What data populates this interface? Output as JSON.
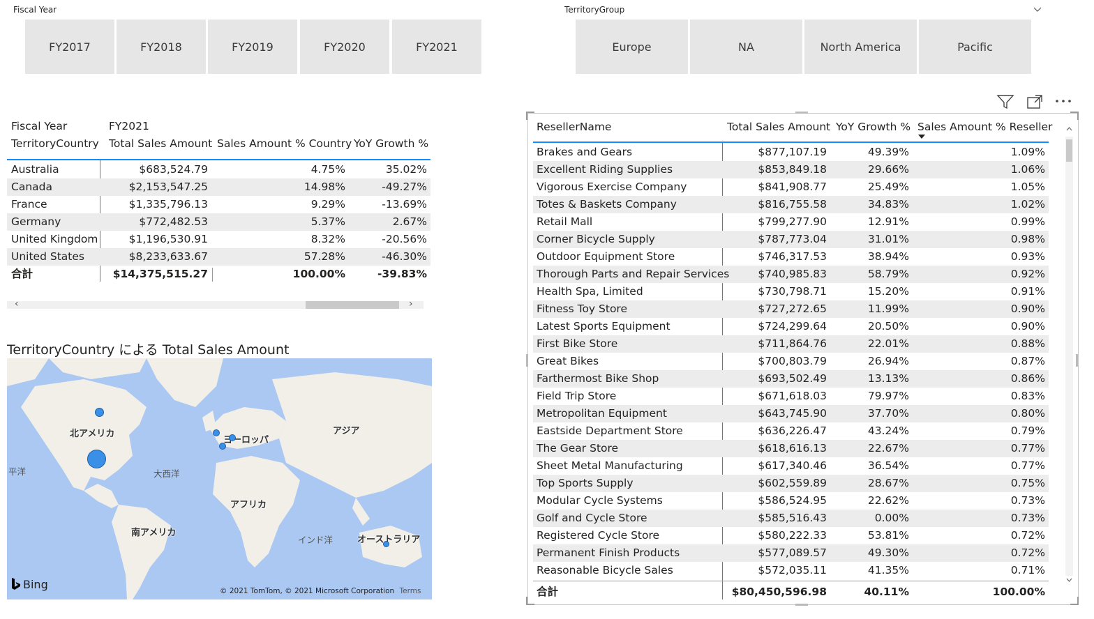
{
  "fiscal_slicer": {
    "title": "Fiscal Year",
    "items": [
      "FY2017",
      "FY2018",
      "FY2019",
      "FY2020",
      "FY2021"
    ]
  },
  "territory_slicer": {
    "title": "TerritoryGroup",
    "items": [
      "Europe",
      "NA",
      "North America",
      "Pacific"
    ]
  },
  "matrix": {
    "col_header_label": "Fiscal Year",
    "col_header_value": "FY2021",
    "row_header": "TerritoryCountry",
    "measures": [
      "Total Sales Amount",
      "Sales Amount % Country",
      "YoY Growth %"
    ],
    "rows": [
      {
        "country": "Australia",
        "sales": "$683,524.79",
        "pct": "4.75%",
        "yoy": "35.02%"
      },
      {
        "country": "Canada",
        "sales": "$2,153,547.25",
        "pct": "14.98%",
        "yoy": "-49.27%"
      },
      {
        "country": "France",
        "sales": "$1,335,796.13",
        "pct": "9.29%",
        "yoy": "-13.69%"
      },
      {
        "country": "Germany",
        "sales": "$772,482.53",
        "pct": "5.37%",
        "yoy": "2.67%"
      },
      {
        "country": "United Kingdom",
        "sales": "$1,196,530.91",
        "pct": "8.32%",
        "yoy": "-20.56%"
      },
      {
        "country": "United States",
        "sales": "$8,233,633.67",
        "pct": "57.28%",
        "yoy": "-46.30%"
      }
    ],
    "total": {
      "label": "合計",
      "sales": "$14,375,515.27",
      "pct": "100.00%",
      "yoy": "-39.83%"
    },
    "scroll_left": "‹",
    "scroll_right": "›"
  },
  "map": {
    "title": "TerritoryCountry による Total Sales Amount",
    "labels": {
      "north_america": "北アメリカ",
      "europe": "ヨーロッパ",
      "asia": "アジア",
      "africa": "アフリカ",
      "south_america": "南アメリカ",
      "oceania": "オーストラリア",
      "atlantic": "大西洋",
      "pacific": "平洋",
      "indian": "インド洋"
    },
    "bing": "Bing",
    "copyright": "© 2021 TomTom, © 2021 Microsoft Corporation",
    "terms": "Terms"
  },
  "reseller_table": {
    "headers": [
      "ResellerName",
      "Total Sales Amount",
      "YoY Growth %",
      "Sales Amount % Reseller"
    ],
    "rows": [
      {
        "name": "Brakes and Gears",
        "sales": "$877,107.19",
        "yoy": "49.39%",
        "pct": "1.09%"
      },
      {
        "name": "Excellent Riding Supplies",
        "sales": "$853,849.18",
        "yoy": "29.66%",
        "pct": "1.06%"
      },
      {
        "name": "Vigorous Exercise Company",
        "sales": "$841,908.77",
        "yoy": "25.49%",
        "pct": "1.05%"
      },
      {
        "name": "Totes & Baskets Company",
        "sales": "$816,755.58",
        "yoy": "34.83%",
        "pct": "1.02%"
      },
      {
        "name": "Retail Mall",
        "sales": "$799,277.90",
        "yoy": "12.91%",
        "pct": "0.99%"
      },
      {
        "name": "Corner Bicycle Supply",
        "sales": "$787,773.04",
        "yoy": "31.01%",
        "pct": "0.98%"
      },
      {
        "name": "Outdoor Equipment Store",
        "sales": "$746,317.53",
        "yoy": "38.94%",
        "pct": "0.93%"
      },
      {
        "name": "Thorough Parts and Repair Services",
        "sales": "$740,985.83",
        "yoy": "58.79%",
        "pct": "0.92%"
      },
      {
        "name": "Health Spa, Limited",
        "sales": "$730,798.71",
        "yoy": "15.20%",
        "pct": "0.91%"
      },
      {
        "name": "Fitness Toy Store",
        "sales": "$727,272.65",
        "yoy": "11.99%",
        "pct": "0.90%"
      },
      {
        "name": "Latest Sports Equipment",
        "sales": "$724,299.64",
        "yoy": "20.50%",
        "pct": "0.90%"
      },
      {
        "name": "First Bike Store",
        "sales": "$711,864.76",
        "yoy": "22.01%",
        "pct": "0.88%"
      },
      {
        "name": "Great Bikes",
        "sales": "$700,803.79",
        "yoy": "26.94%",
        "pct": "0.87%"
      },
      {
        "name": "Farthermost Bike Shop",
        "sales": "$693,502.49",
        "yoy": "13.13%",
        "pct": "0.86%"
      },
      {
        "name": "Field Trip Store",
        "sales": "$671,618.03",
        "yoy": "79.97%",
        "pct": "0.83%"
      },
      {
        "name": "Metropolitan Equipment",
        "sales": "$643,745.90",
        "yoy": "37.70%",
        "pct": "0.80%"
      },
      {
        "name": "Eastside Department Store",
        "sales": "$636,226.47",
        "yoy": "43.24%",
        "pct": "0.79%"
      },
      {
        "name": "The Gear Store",
        "sales": "$618,616.13",
        "yoy": "22.67%",
        "pct": "0.77%"
      },
      {
        "name": "Sheet Metal Manufacturing",
        "sales": "$617,340.46",
        "yoy": "36.54%",
        "pct": "0.77%"
      },
      {
        "name": "Top Sports Supply",
        "sales": "$602,559.89",
        "yoy": "28.67%",
        "pct": "0.75%"
      },
      {
        "name": "Modular Cycle Systems",
        "sales": "$586,524.95",
        "yoy": "22.62%",
        "pct": "0.73%"
      },
      {
        "name": "Golf and Cycle Store",
        "sales": "$585,516.43",
        "yoy": "0.00%",
        "pct": "0.73%"
      },
      {
        "name": "Registered Cycle Store",
        "sales": "$580,222.33",
        "yoy": "53.81%",
        "pct": "0.72%"
      },
      {
        "name": "Permanent Finish Products",
        "sales": "$577,089.57",
        "yoy": "49.30%",
        "pct": "0.72%"
      },
      {
        "name": "Reasonable Bicycle Sales",
        "sales": "$572,035.11",
        "yoy": "41.35%",
        "pct": "0.71%"
      }
    ],
    "total": {
      "label": "合計",
      "sales": "$80,450,596.98",
      "yoy": "40.11%",
      "pct": "100.00%"
    }
  },
  "colors": {
    "tile_bg": "#e6e6e6",
    "band": "#ececec",
    "accent": "#118dff",
    "ocean": "#aac8f2",
    "land": "#f2efe9",
    "bubble": "#3a8fe6"
  }
}
